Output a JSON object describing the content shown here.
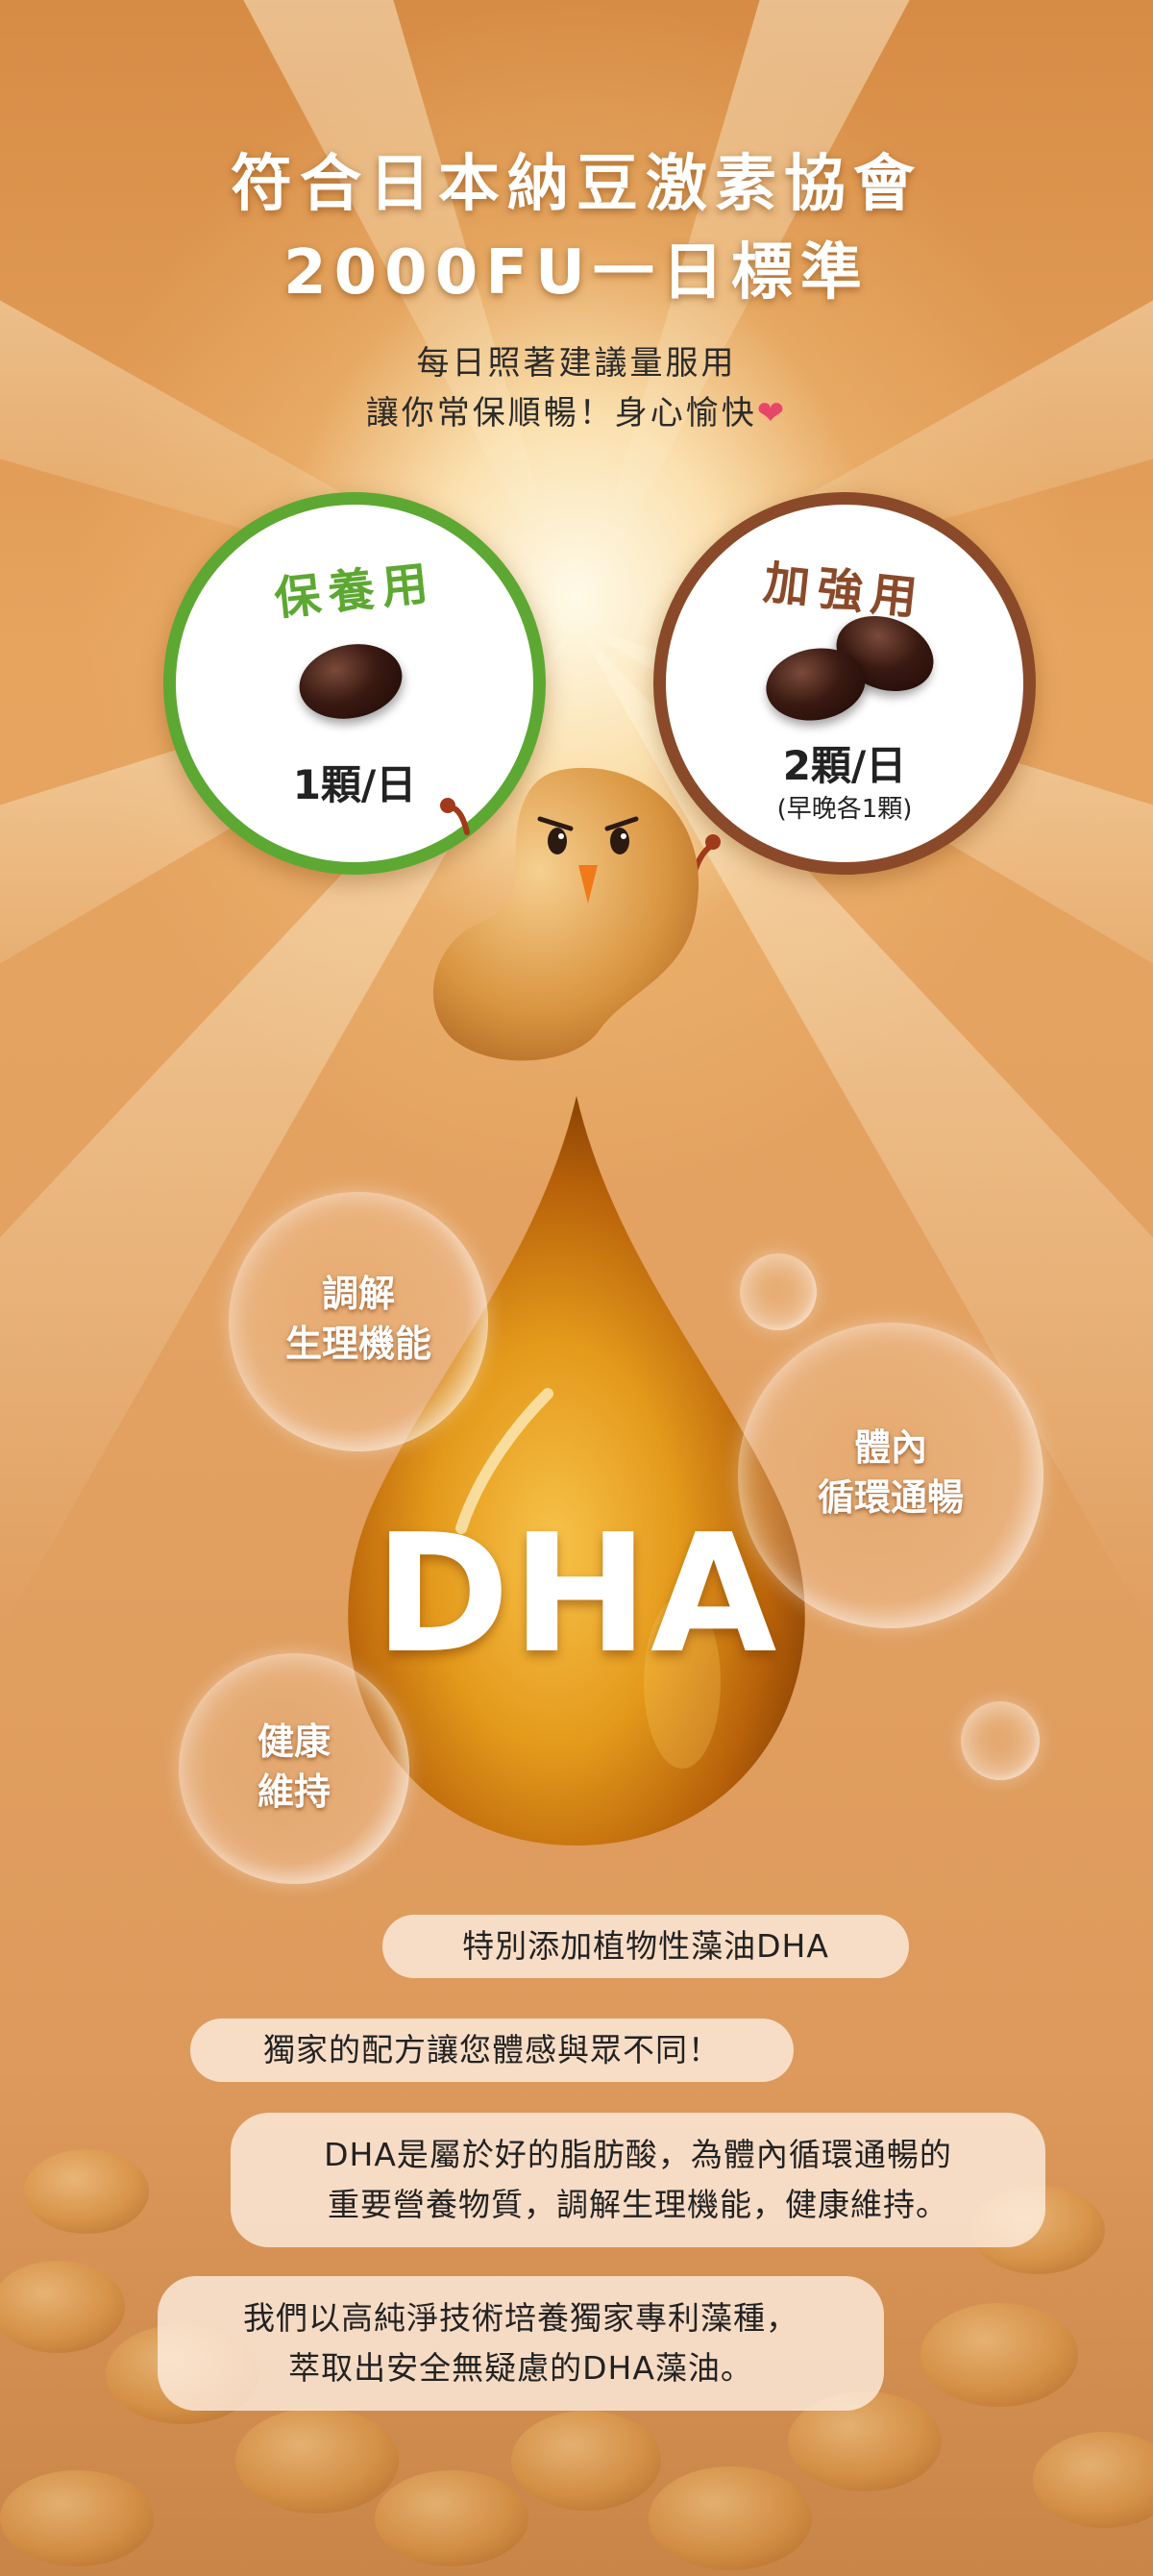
{
  "headline": {
    "line1": "符合日本納豆激素協會",
    "line2": "2000FU一日標準"
  },
  "intro": {
    "line1": "每日照著建議量服用",
    "line2": "讓你常保順暢！身心愉快",
    "heart_icon": "❤"
  },
  "dosage": {
    "maintenance": {
      "label": "保養用",
      "amount": "1顆/日",
      "pill_count": 1
    },
    "boost": {
      "label": "加強用",
      "amount": "2顆/日",
      "note": "(早晚各1顆)",
      "pill_count": 2
    }
  },
  "benefits": [
    {
      "line1": "調解",
      "line2": "生理機能"
    },
    {
      "line1": "體內",
      "line2": "循環通暢"
    },
    {
      "line1": "健康",
      "line2": "維持"
    }
  ],
  "drop_label": "DHA",
  "descriptions": {
    "tag1": "特別添加植物性藻油DHA",
    "tag2": "獨家的配方讓您體感與眾不同！",
    "tag3_line1": "DHA是屬於好的脂肪酸，為體內循環通暢的",
    "tag3_line2": "重要營養物質，調解生理機能，健康維持。",
    "tag4_line1": "我們以高純淨技術培養獨家專利藻種，",
    "tag4_line2": "萃取出安全無疑慮的DHA藻油。"
  },
  "colors": {
    "maintenance_ring": "#5da832",
    "boost_ring": "#8a4a2a",
    "background": "#dd9a5c",
    "heart": "#e8456b"
  }
}
